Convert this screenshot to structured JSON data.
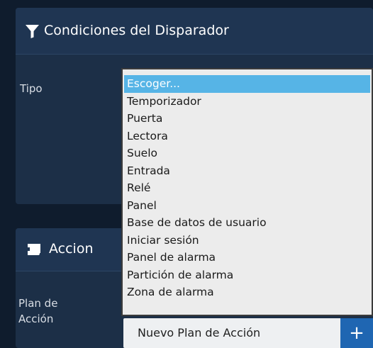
{
  "trigger_panel": {
    "title": "Condiciones del Disparador",
    "icon": "filter-icon",
    "type_label": "Tipo"
  },
  "action_panel": {
    "title": "Accion",
    "icon": "scroll-icon",
    "plan_label_line1": "Plan de",
    "plan_label_line2": "Acción",
    "plan_value": "Nuevo Plan de Acción",
    "add_button_label": "+"
  },
  "type_dropdown": {
    "selected": "Escoger...",
    "options": [
      "Escoger...",
      "Temporizador",
      "Puerta",
      "Lectora",
      "Suelo",
      "Entrada",
      "Relé",
      "Panel",
      "Base de datos de usuario",
      "Iniciar sesión",
      "Panel de alarma",
      "Partición de alarma",
      "Zona de alarma"
    ]
  },
  "colors": {
    "background": "#0f1c2d",
    "panel": "#1c2f47",
    "highlight": "#56b4e6",
    "add_button": "#1f66b2"
  }
}
